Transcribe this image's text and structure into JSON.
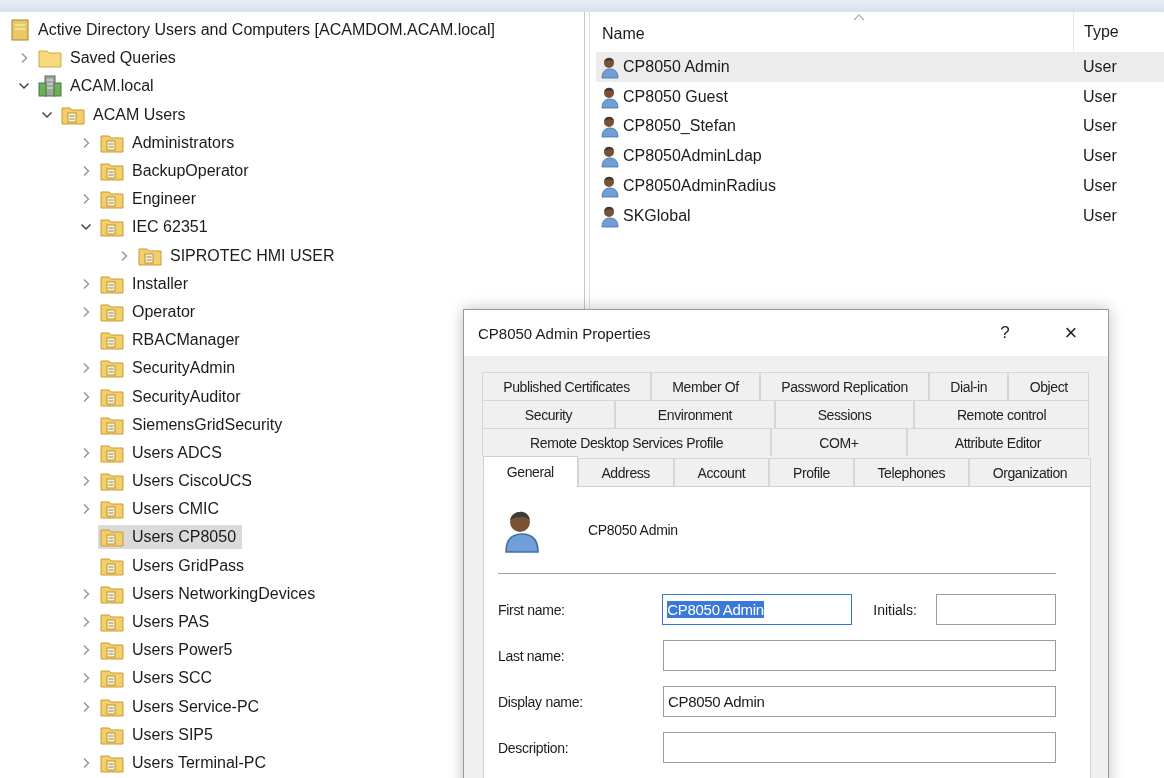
{
  "tree": [
    {
      "label": "Active Directory Users and Computers [ACAMDOM.ACAM.local]",
      "kind": "console",
      "selected": false,
      "children": [
        {
          "label": "Saved Queries",
          "kind": "folder",
          "expanded": false,
          "selected": false
        },
        {
          "label": "ACAM.local",
          "kind": "domain",
          "expanded": true,
          "selected": false,
          "children": [
            {
              "label": "ACAM Users",
              "kind": "unit",
              "expanded": true,
              "selected": false,
              "children": [
                {
                  "label": "Administrators",
                  "kind": "unit",
                  "expanded": false,
                  "selected": false
                },
                {
                  "label": "BackupOperator",
                  "kind": "unit",
                  "expanded": false,
                  "selected": false
                },
                {
                  "label": "Engineer",
                  "kind": "unit",
                  "expanded": false,
                  "selected": false
                },
                {
                  "label": "IEC 62351",
                  "kind": "unit",
                  "expanded": true,
                  "selected": false,
                  "children": [
                    {
                      "label": "SIPROTEC HMI USER",
                      "kind": "unit",
                      "expanded": false,
                      "selected": false
                    }
                  ]
                },
                {
                  "label": "Installer",
                  "kind": "unit",
                  "expanded": false,
                  "selected": false
                },
                {
                  "label": "Operator",
                  "kind": "unit",
                  "expanded": false,
                  "selected": false
                },
                {
                  "label": "RBACManager",
                  "kind": "unit",
                  "selected": false
                },
                {
                  "label": "SecurityAdmin",
                  "kind": "unit",
                  "expanded": false,
                  "selected": false
                },
                {
                  "label": "SecurityAuditor",
                  "kind": "unit",
                  "expanded": false,
                  "selected": false
                },
                {
                  "label": "SiemensGridSecurity",
                  "kind": "unit",
                  "selected": false
                },
                {
                  "label": "Users ADCS",
                  "kind": "unit",
                  "expanded": false,
                  "selected": false
                },
                {
                  "label": "Users CiscoUCS",
                  "kind": "unit",
                  "expanded": false,
                  "selected": false
                },
                {
                  "label": "Users CMIC",
                  "kind": "unit",
                  "expanded": false,
                  "selected": false
                },
                {
                  "label": "Users CP8050",
                  "kind": "unit",
                  "selected": true
                },
                {
                  "label": "Users GridPass",
                  "kind": "unit",
                  "selected": false
                },
                {
                  "label": "Users NetworkingDevices",
                  "kind": "unit",
                  "expanded": false,
                  "selected": false
                },
                {
                  "label": "Users PAS",
                  "kind": "unit",
                  "expanded": false,
                  "selected": false
                },
                {
                  "label": "Users Power5",
                  "kind": "unit",
                  "expanded": false,
                  "selected": false
                },
                {
                  "label": "Users SCC",
                  "kind": "unit",
                  "expanded": false,
                  "selected": false
                },
                {
                  "label": "Users Service-PC",
                  "kind": "unit",
                  "expanded": false,
                  "selected": false
                },
                {
                  "label": "Users SIP5",
                  "kind": "unit",
                  "selected": false
                },
                {
                  "label": "Users Terminal-PC",
                  "kind": "unit",
                  "expanded": false,
                  "selected": false
                }
              ]
            }
          ]
        }
      ]
    }
  ],
  "list": {
    "columns": [
      "Name",
      "Type"
    ],
    "rows": [
      {
        "name": "CP8050 Admin",
        "type": "User",
        "selected": true
      },
      {
        "name": "CP8050 Guest",
        "type": "User",
        "selected": false
      },
      {
        "name": "CP8050_Stefan",
        "type": "User",
        "selected": false
      },
      {
        "name": "CP8050AdminLdap",
        "type": "User",
        "selected": false
      },
      {
        "name": "CP8050AdminRadius",
        "type": "User",
        "selected": false
      },
      {
        "name": "SKGlobal",
        "type": "User",
        "selected": false
      }
    ]
  },
  "dialog": {
    "title": "CP8050 Admin Properties",
    "help": "?",
    "close": "×",
    "tab_rows": [
      [
        {
          "label": "Published Certificates",
          "selected": false
        },
        {
          "label": "Member Of",
          "selected": false
        },
        {
          "label": "Password Replication",
          "selected": false
        },
        {
          "label": "Dial-in",
          "selected": false
        },
        {
          "label": "Object",
          "selected": false
        }
      ],
      [
        {
          "label": "Security",
          "selected": false
        },
        {
          "label": "Environment",
          "selected": false
        },
        {
          "label": "Sessions",
          "selected": false
        },
        {
          "label": "Remote control",
          "selected": false
        }
      ],
      [
        {
          "label": "Remote Desktop Services Profile",
          "selected": false
        },
        {
          "label": "COM+",
          "selected": false
        },
        {
          "label": "Attribute Editor",
          "selected": false
        }
      ],
      [
        {
          "label": "General",
          "selected": true
        },
        {
          "label": "Address",
          "selected": false
        },
        {
          "label": "Account",
          "selected": false
        },
        {
          "label": "Profile",
          "selected": false
        },
        {
          "label": "Telephones",
          "selected": false
        },
        {
          "label": "Organization",
          "selected": false
        }
      ]
    ],
    "user_name": "CP8050 Admin",
    "fields": [
      {
        "label": "First name:",
        "value": "CP8050 Admin",
        "highlighted": true,
        "initials": {
          "label": "Initials:"
        }
      },
      {
        "label": "Last name:",
        "highlighted": false
      },
      {
        "label": "Display name:",
        "value": "CP8050 Admin",
        "highlighted": false
      },
      {
        "label": "Description:",
        "highlighted": false
      }
    ]
  }
}
